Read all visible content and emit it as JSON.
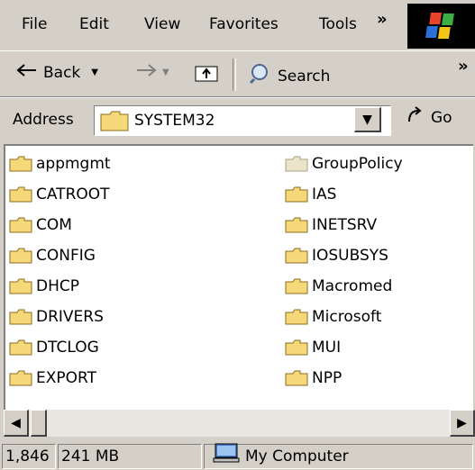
{
  "menu": {
    "items": [
      "File",
      "Edit",
      "View",
      "Favorites",
      "Tools"
    ],
    "overflow": "»"
  },
  "toolbar": {
    "back_label": "Back",
    "search_label": "Search",
    "overflow": "»"
  },
  "address": {
    "label": "Address",
    "value": "SYSTEM32",
    "go_label": "Go"
  },
  "folders": {
    "left": [
      "appmgmt",
      "CATROOT",
      "COM",
      "CONFIG",
      "DHCP",
      "DRIVERS",
      "DTCLOG",
      "EXPORT"
    ],
    "right": [
      "GroupPolicy",
      "IAS",
      "INETSRV",
      "IOSUBSYS",
      "Macromed",
      "Microsoft",
      "MUI",
      "NPP"
    ]
  },
  "status": {
    "count": "1,846",
    "size": "241 MB",
    "location": "My Computer"
  },
  "colors": {
    "chrome": "#d4d0c8",
    "folder": "#f5d87a",
    "folder_dim": "#ece4c8"
  }
}
